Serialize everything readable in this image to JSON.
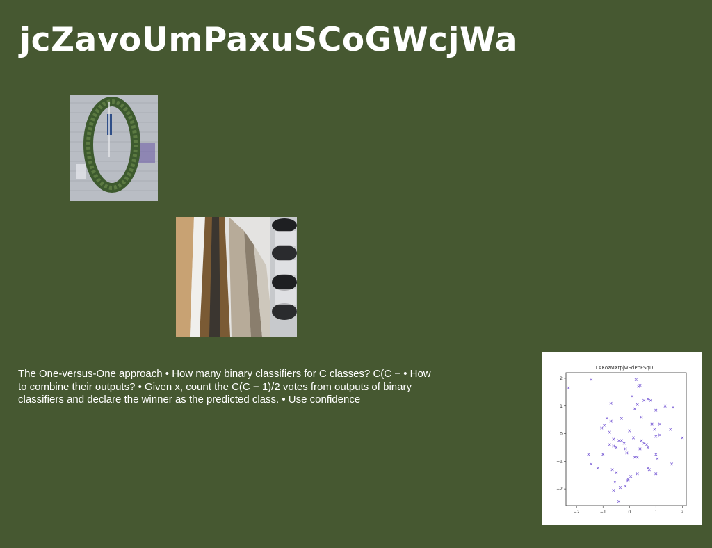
{
  "title": "jcZavoUmPaxuSCoGWcjWa",
  "images": [
    {
      "name": "wreath-photo",
      "alt": "Wreath hanging on a whitewashed brick wall"
    },
    {
      "name": "architecture-photo",
      "alt": "Modern building facade with steel cylinders"
    }
  ],
  "body_text": "The One-versus-One approach • How many binary classifiers for C classes? C(C − • How to combine their outputs? • Given x, count the C(C − 1)/2 votes from outputs of binary classifiers and declare the winner as the predicted class. • Use confidence",
  "chart_data": {
    "type": "scatter",
    "title": "LAKozMXtpjwSdPbFSqD",
    "xlabel": "",
    "ylabel": "",
    "xlim": [
      -2.4,
      2.15
    ],
    "ylim": [
      -2.6,
      2.2
    ],
    "xticks": [
      -2,
      -1,
      0,
      1,
      2
    ],
    "yticks": [
      2,
      1,
      0,
      -1,
      -2
    ],
    "marker": "x",
    "color": "#7b5fd6",
    "grid": false,
    "points": [
      [
        -2.3,
        1.65
      ],
      [
        -1.45,
        1.95
      ],
      [
        0.25,
        1.95
      ],
      [
        0.35,
        1.7
      ],
      [
        0.4,
        1.75
      ],
      [
        -0.7,
        1.1
      ],
      [
        0.3,
        1.05
      ],
      [
        0.1,
        1.35
      ],
      [
        0.55,
        1.2
      ],
      [
        0.7,
        1.25
      ],
      [
        0.8,
        1.2
      ],
      [
        0.2,
        0.9
      ],
      [
        1.35,
        1.0
      ],
      [
        1.65,
        0.95
      ],
      [
        1.0,
        0.85
      ],
      [
        -0.85,
        0.55
      ],
      [
        -0.95,
        0.3
      ],
      [
        -1.05,
        0.2
      ],
      [
        -0.7,
        0.45
      ],
      [
        -0.3,
        0.55
      ],
      [
        0.0,
        0.1
      ],
      [
        0.45,
        0.6
      ],
      [
        0.85,
        0.35
      ],
      [
        1.15,
        0.35
      ],
      [
        0.95,
        0.15
      ],
      [
        1.55,
        0.15
      ],
      [
        2.0,
        -0.15
      ],
      [
        -0.75,
        0.05
      ],
      [
        -0.6,
        -0.2
      ],
      [
        -0.4,
        -0.25
      ],
      [
        -0.3,
        -0.25
      ],
      [
        -0.75,
        -0.4
      ],
      [
        -0.6,
        -0.45
      ],
      [
        -0.5,
        -0.5
      ],
      [
        -0.2,
        -0.35
      ],
      [
        0.15,
        -0.15
      ],
      [
        0.45,
        -0.25
      ],
      [
        0.55,
        -0.35
      ],
      [
        0.65,
        -0.4
      ],
      [
        1.0,
        -0.1
      ],
      [
        1.15,
        -0.05
      ],
      [
        -0.15,
        -0.55
      ],
      [
        0.4,
        -0.55
      ],
      [
        0.7,
        -0.5
      ],
      [
        -1.55,
        -0.75
      ],
      [
        -1.0,
        -0.75
      ],
      [
        -0.1,
        -0.7
      ],
      [
        0.3,
        -0.85
      ],
      [
        0.2,
        -0.85
      ],
      [
        1.0,
        -0.75
      ],
      [
        1.05,
        -0.9
      ],
      [
        -1.45,
        -1.1
      ],
      [
        -1.2,
        -1.25
      ],
      [
        -0.65,
        -1.3
      ],
      [
        -0.5,
        -1.4
      ],
      [
        0.3,
        -1.45
      ],
      [
        0.7,
        -1.25
      ],
      [
        0.75,
        -1.3
      ],
      [
        1.0,
        -1.45
      ],
      [
        1.6,
        -1.1
      ],
      [
        -0.55,
        -1.75
      ],
      [
        -0.15,
        -1.9
      ],
      [
        -0.05,
        -1.7
      ],
      [
        0.05,
        -1.55
      ],
      [
        -0.35,
        -1.95
      ],
      [
        -0.6,
        -2.05
      ],
      [
        -0.4,
        -2.45
      ],
      [
        -0.05,
        -1.65
      ]
    ]
  }
}
